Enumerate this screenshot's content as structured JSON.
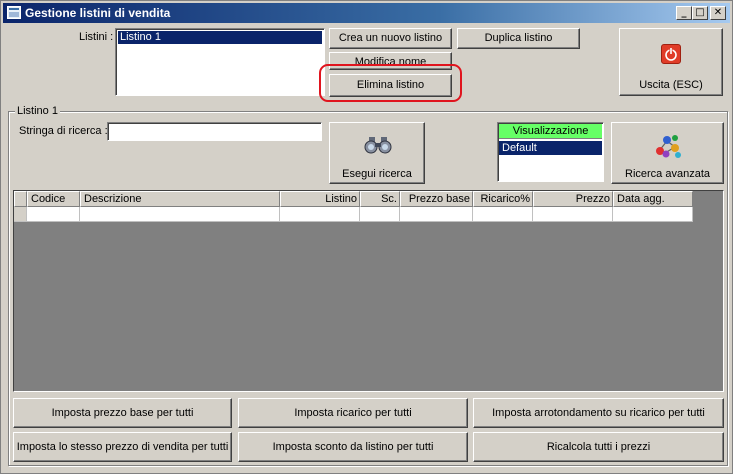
{
  "window": {
    "title": "Gestione listini di vendita",
    "minimize_glyph": "_",
    "maximize_glyph": "□",
    "close_glyph": "✕"
  },
  "listini": {
    "label": "Listini :",
    "items": [
      "Listino 1"
    ],
    "selected_index": 0
  },
  "buttons": {
    "crea": "Crea un nuovo listino",
    "duplica": "Duplica listino",
    "modifica": "Modifica nome",
    "elimina": "Elimina listino",
    "uscita": "Uscita (ESC)",
    "esegui": "Esegui ricerca",
    "ricerca_avanzata": "Ricerca avanzata"
  },
  "group": {
    "title": "Listino 1",
    "search_label": "Stringa di ricerca :",
    "search_value": ""
  },
  "visualizzazione": {
    "header": "Visualizzazione",
    "options": [
      "Default"
    ],
    "selected_index": 0
  },
  "grid": {
    "columns": [
      "",
      "Codice",
      "Descrizione",
      "Listino",
      "Sc.",
      "Prezzo base",
      "Ricarico%",
      "Prezzo",
      "Data agg."
    ],
    "rows": [
      [
        "",
        "",
        "",
        "",
        "",
        "",
        "",
        "",
        ""
      ]
    ]
  },
  "bottom_buttons": {
    "row1": [
      "Imposta prezzo base per tutti",
      "Imposta ricarico per tutti",
      "Imposta arrotondamento su ricarico per tutti"
    ],
    "row2": [
      "Imposta lo stesso prezzo di vendita per tutti",
      "Imposta sconto da listino per tutti",
      "Ricalcola tutti i prezzi"
    ]
  },
  "colors": {
    "title_gradient_start": "#0a246a",
    "selection": "#0a246a",
    "visualizzazione_header": "#66ff66",
    "highlight_ring": "#e0141e",
    "exit_icon": "#e03c28"
  },
  "icons": {
    "exit": "power-icon",
    "search": "binoculars-icon",
    "advanced": "colored-molecules-icon"
  }
}
